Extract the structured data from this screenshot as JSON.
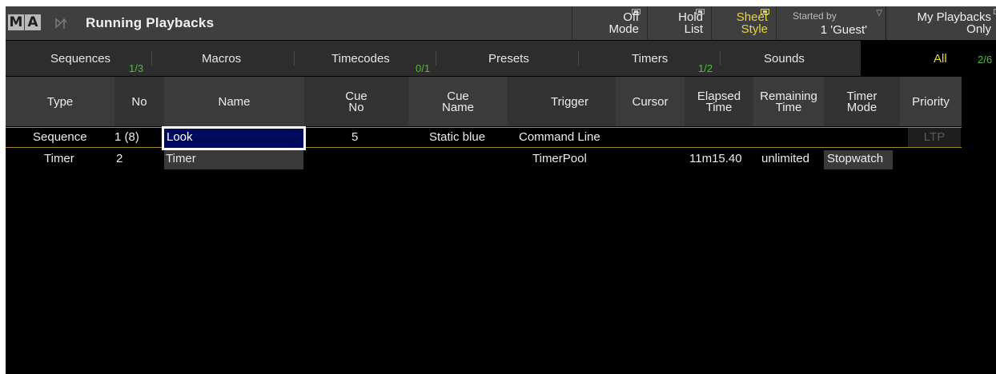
{
  "titlebar": {
    "logo_m": "M",
    "logo_a": "A",
    "pin_icon": "pin-icon",
    "title": "Running Playbacks",
    "buttons": {
      "off_mode": {
        "line1": "Off",
        "line2": "Mode"
      },
      "hold_list": {
        "line1": "Hold",
        "line2": "List"
      },
      "sheet_style": {
        "line1": "Sheet",
        "line2": "Style"
      },
      "started_by": {
        "label": "Started by",
        "value": "1 'Guest'"
      },
      "my_playbacks": {
        "line1": "My Playbacks",
        "line2": "Only"
      }
    }
  },
  "filters": [
    {
      "label": "Sequences",
      "count": "1/3"
    },
    {
      "label": "Macros",
      "count": ""
    },
    {
      "label": "Timecodes",
      "count": "0/1"
    },
    {
      "label": "Presets",
      "count": ""
    },
    {
      "label": "Timers",
      "count": "1/2"
    },
    {
      "label": "Sounds",
      "count": ""
    },
    {
      "label": "All",
      "count": "2/6"
    }
  ],
  "columns": {
    "type": "Type",
    "no": "No",
    "name": "Name",
    "cue_no": {
      "l1": "Cue",
      "l2": "No"
    },
    "cue_name": {
      "l1": "Cue",
      "l2": "Name"
    },
    "trigger": "Trigger",
    "cursor": "Cursor",
    "elapsed": {
      "l1": "Elapsed",
      "l2": "Time"
    },
    "remaining": {
      "l1": "Remaining",
      "l2": "Time"
    },
    "timer_mode": {
      "l1": "Timer",
      "l2": "Mode"
    },
    "priority": "Priority"
  },
  "rows": [
    {
      "type": "Sequence",
      "no": "1 (8)",
      "name": "Look",
      "cue_no": "5",
      "cue_name": "Static blue",
      "trigger": "Command Line",
      "cursor": "",
      "elapsed": "",
      "remaining": "",
      "timer_mode": "",
      "priority": "LTP"
    },
    {
      "type": "Timer",
      "no": "2",
      "name": "Timer",
      "cue_no": "",
      "cue_name": "",
      "trigger": "TimerPool",
      "cursor": "",
      "elapsed": "11m15.40",
      "remaining": "unlimited",
      "timer_mode": "Stopwatch",
      "priority": ""
    }
  ],
  "colors": {
    "accent_yellow": "#e8d440",
    "count_green": "#4ec22f",
    "selection_blue": "#000a5c"
  }
}
